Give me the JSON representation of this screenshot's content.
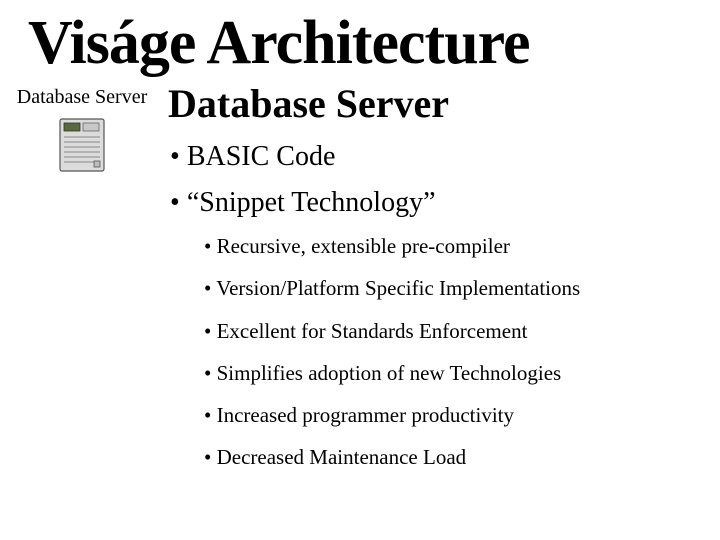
{
  "title": "Viságe Architecture",
  "left": {
    "label": "Database Server"
  },
  "subheading": "Database Server",
  "bullets": {
    "b1": "BASIC Code",
    "b2": "“Snippet Technology”",
    "sub": {
      "s1": "Recursive, extensible pre-compiler",
      "s2": "Version/Platform Specific Implementations",
      "s3": "Excellent for Standards Enforcement",
      "s4": "Simplifies adoption of new Technologies",
      "s5": "Increased programmer productivity",
      "s6": "Decreased Maintenance Load"
    }
  }
}
